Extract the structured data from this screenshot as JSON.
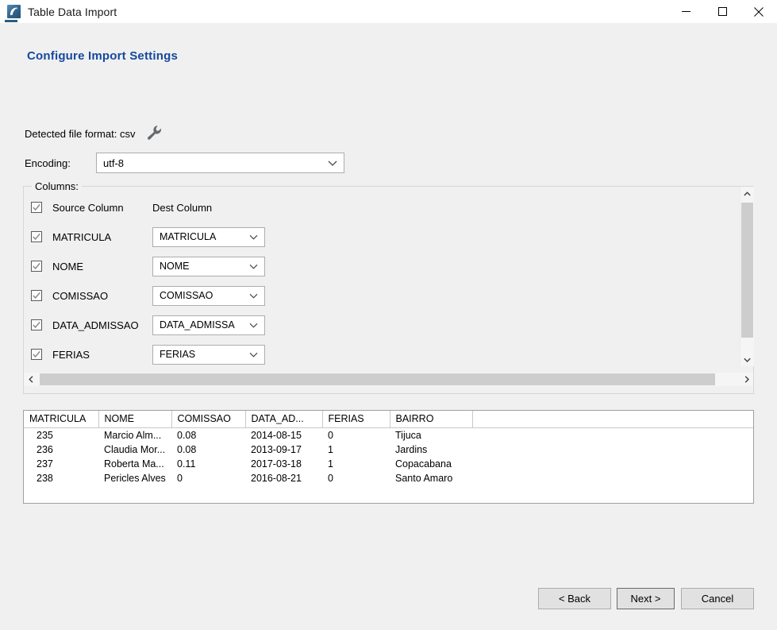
{
  "window": {
    "title": "Table Data Import",
    "icon": "workbench-dolphin-icon",
    "controls": {
      "minimize": "minimize-icon",
      "maximize": "maximize-icon",
      "close": "close-icon"
    }
  },
  "page": {
    "heading": "Configure Import Settings",
    "heading_color": "#14489e"
  },
  "detected": {
    "label": "Detected file format: csv",
    "settings_icon": "wrench-icon"
  },
  "encoding": {
    "label": "Encoding:",
    "value": "utf-8",
    "options": [
      "utf-8"
    ]
  },
  "columns_group": {
    "legend": "Columns:",
    "headers": {
      "source": "Source Column",
      "dest": "Dest Column"
    },
    "select_all_checked": true,
    "rows": [
      {
        "checked": true,
        "source": "MATRICULA",
        "dest": "MATRICULA"
      },
      {
        "checked": true,
        "source": "NOME",
        "dest": "NOME"
      },
      {
        "checked": true,
        "source": "COMISSAO",
        "dest": "COMISSAO"
      },
      {
        "checked": true,
        "source": "DATA_ADMISSAO",
        "dest": "DATA_ADMISSA"
      },
      {
        "checked": true,
        "source": "FERIAS",
        "dest": "FERIAS"
      }
    ],
    "vscrollbar": {
      "up": "chevron-up-icon",
      "down": "chevron-down-icon"
    },
    "hscrollbar": {
      "left": "chevron-left-icon",
      "right": "chevron-right-icon"
    }
  },
  "preview": {
    "columns": [
      "MATRICULA",
      "NOME",
      "COMISSAO",
      "DATA_AD...",
      "FERIAS",
      "BAIRRO",
      ""
    ],
    "rows": [
      [
        "235",
        "Marcio Alm...",
        "0.08",
        "2014-08-15",
        "0",
        "Tijuca",
        ""
      ],
      [
        "236",
        "Claudia Mor...",
        "0.08",
        "2013-09-17",
        "1",
        "Jardins",
        ""
      ],
      [
        "237",
        "Roberta Ma...",
        "0.11",
        "2017-03-18",
        "1",
        "Copacabana",
        ""
      ],
      [
        "238",
        "Pericles Alves",
        "0",
        "2016-08-21",
        "0",
        "Santo Amaro",
        ""
      ]
    ]
  },
  "footer": {
    "back": "< Back",
    "next": "Next >",
    "cancel": "Cancel"
  }
}
